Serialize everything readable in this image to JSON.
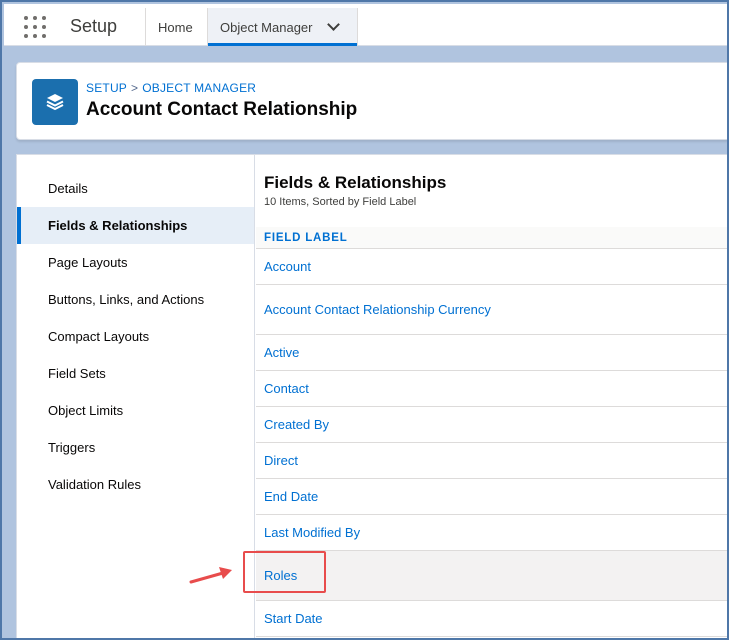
{
  "global_nav": {
    "app_name": "Setup",
    "tabs": [
      {
        "label": "Home"
      },
      {
        "label": "Object Manager"
      }
    ]
  },
  "page_header": {
    "breadcrumb": [
      "SETUP",
      "OBJECT MANAGER"
    ],
    "breadcrumb_separator": ">",
    "title": "Account Contact Relationship",
    "icon": "layers-icon"
  },
  "sidebar": {
    "items": [
      {
        "label": "Details"
      },
      {
        "label": "Fields & Relationships",
        "selected": true
      },
      {
        "label": "Page Layouts"
      },
      {
        "label": "Buttons, Links, and Actions"
      },
      {
        "label": "Compact Layouts"
      },
      {
        "label": "Field Sets"
      },
      {
        "label": "Object Limits"
      },
      {
        "label": "Triggers"
      },
      {
        "label": "Validation Rules"
      }
    ]
  },
  "main": {
    "title": "Fields & Relationships",
    "subtitle": "10 Items, Sorted by Field Label",
    "column_header": "FIELD LABEL",
    "rows": [
      {
        "label": "Account"
      },
      {
        "label": "Account Contact Relationship Currency"
      },
      {
        "label": "Active"
      },
      {
        "label": "Contact"
      },
      {
        "label": "Created By"
      },
      {
        "label": "Direct"
      },
      {
        "label": "End Date"
      },
      {
        "label": "Last Modified By"
      },
      {
        "label": "Roles",
        "highlighted": true
      },
      {
        "label": "Start Date"
      }
    ]
  },
  "annotation": {
    "target": "Roles",
    "color": "#e84c4c"
  },
  "colors": {
    "brand": "#0070d2",
    "frame": "#4f77a8",
    "icon_bg": "#1b6fae"
  }
}
